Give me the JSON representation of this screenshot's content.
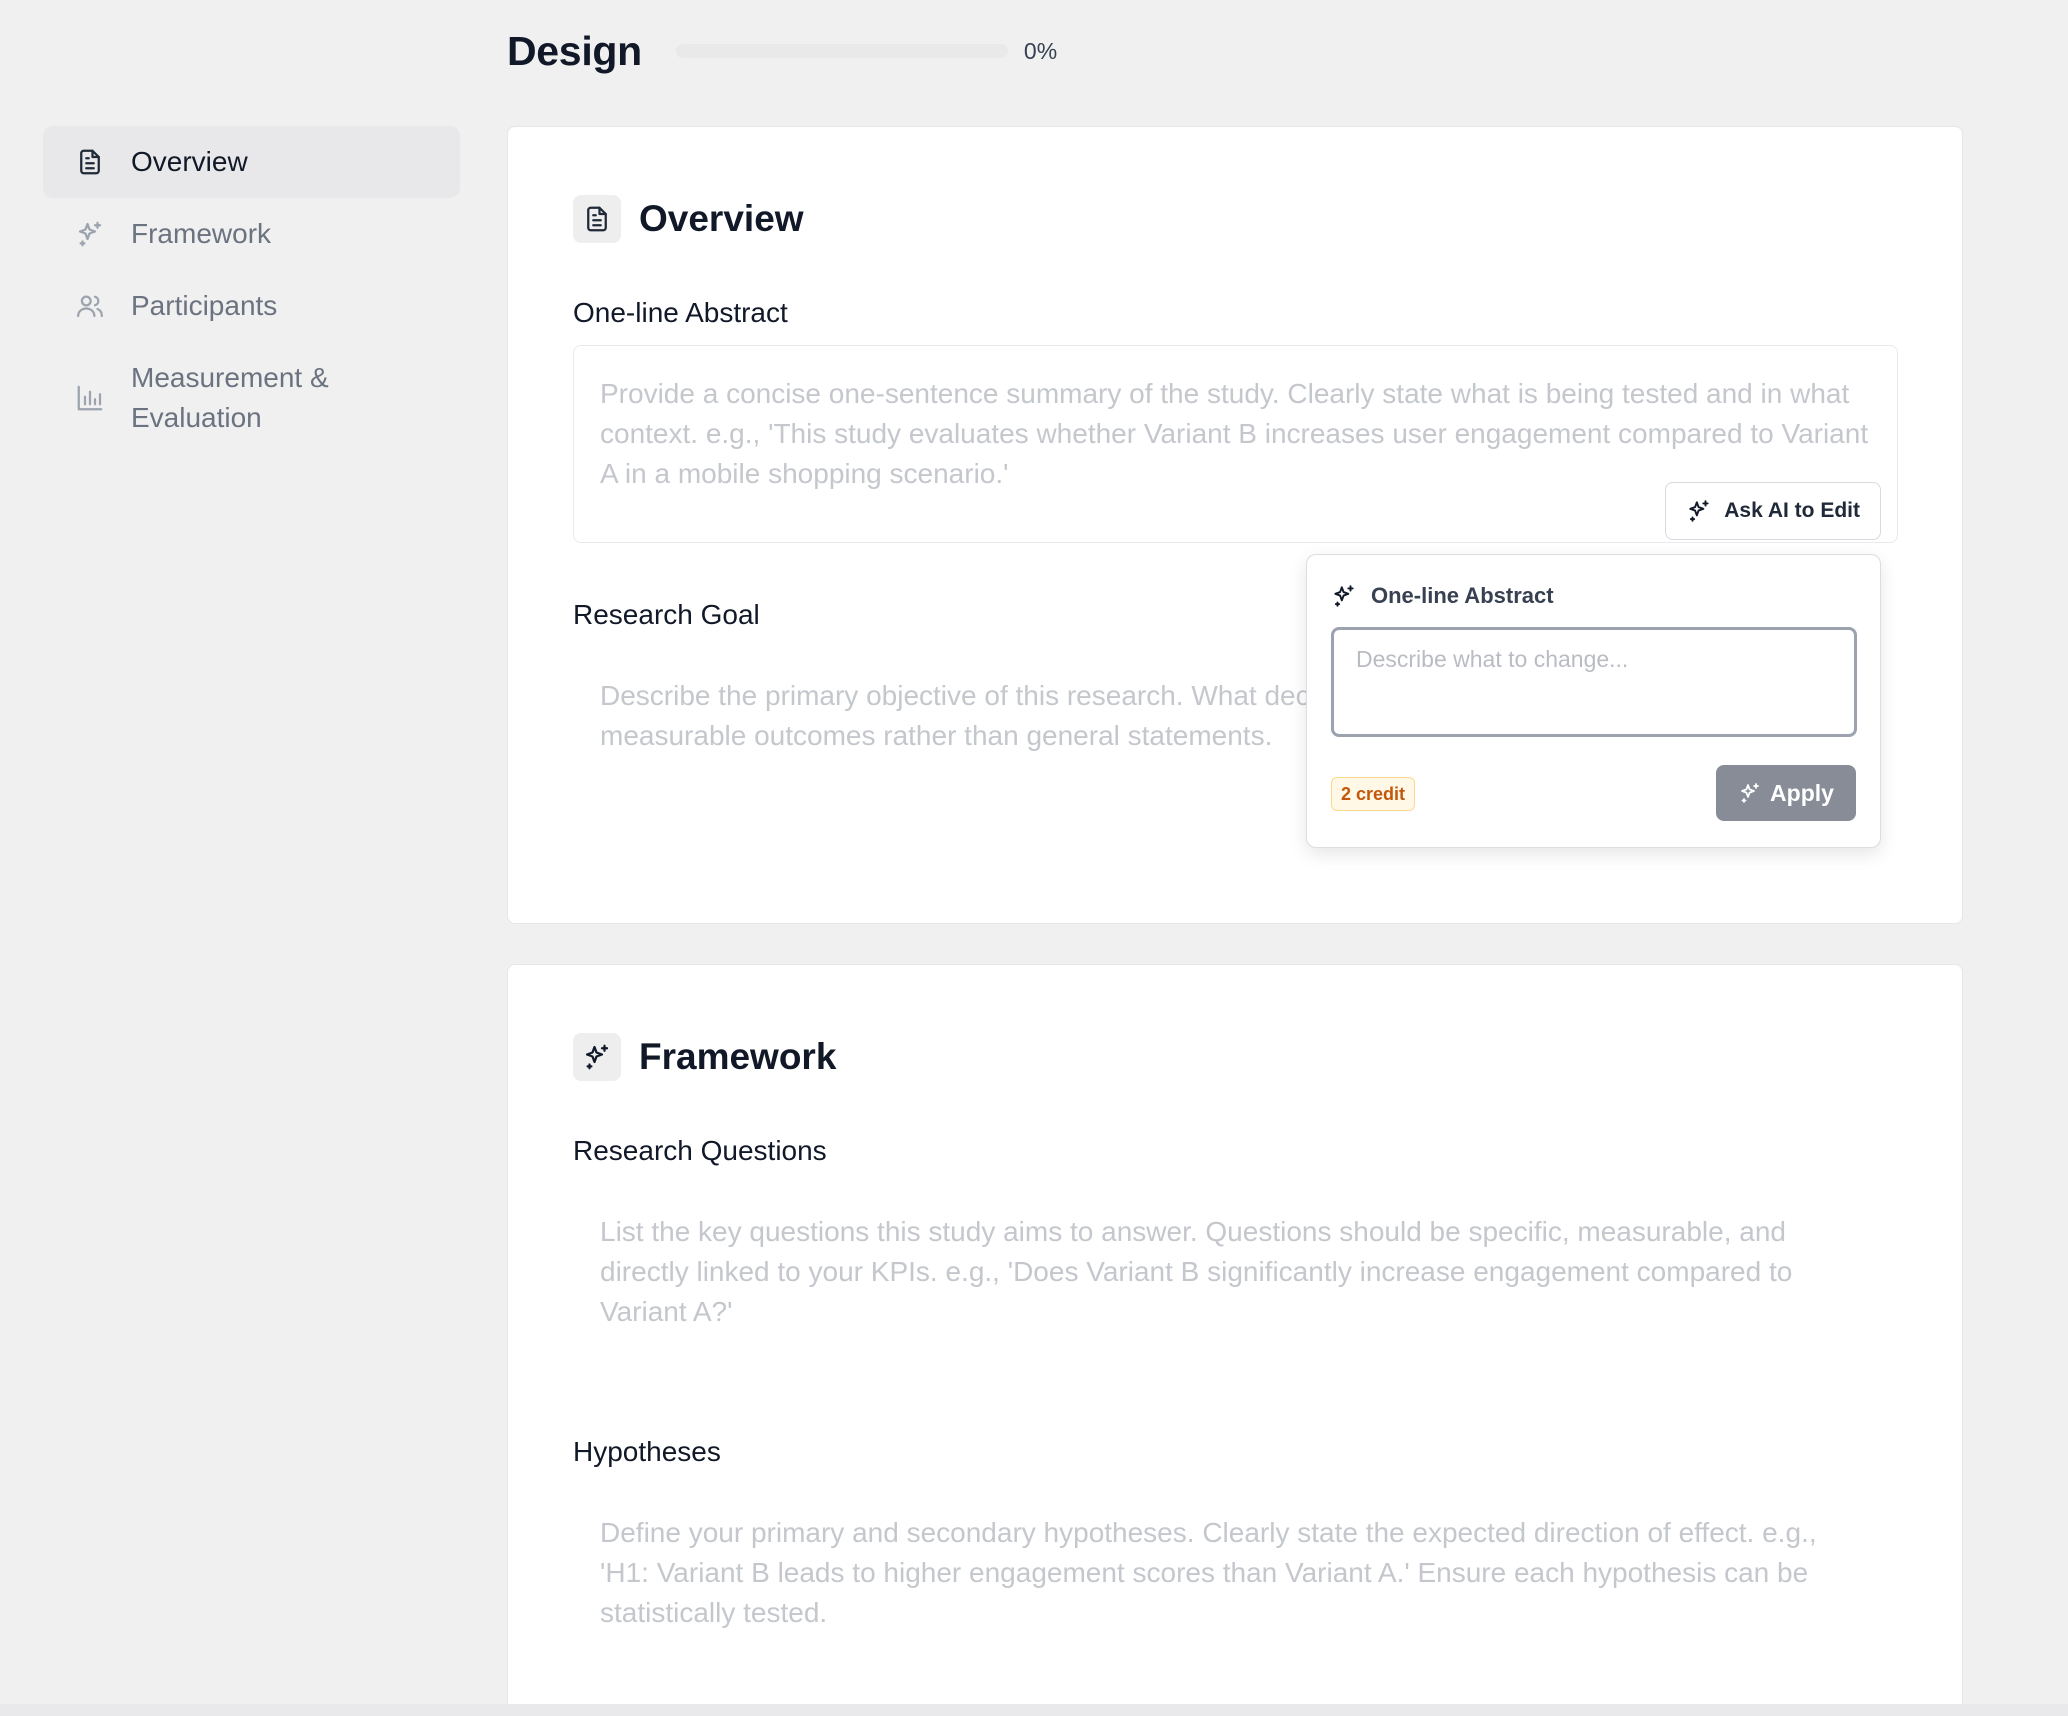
{
  "header": {
    "title": "Design",
    "progress_label": "0%",
    "progress_value": 0
  },
  "sidebar": {
    "items": [
      {
        "label": "Overview",
        "icon": "document-icon",
        "active": true
      },
      {
        "label": "Framework",
        "icon": "sparkles-icon",
        "active": false
      },
      {
        "label": "Participants",
        "icon": "users-icon",
        "active": false
      },
      {
        "label": "Measurement & Evaluation",
        "icon": "bar-chart-icon",
        "active": false
      }
    ]
  },
  "overview": {
    "title": "Overview",
    "abstract_label": "One-line Abstract",
    "abstract_placeholder": "Provide a concise one-sentence summary of the study. Clearly state what is being tested and in what context. e.g., 'This study evaluates whether Variant B increases user engagement compared to Variant A in a mobile shopping scenario.'",
    "ask_ai_label": "Ask AI to Edit",
    "goal_label": "Research Goal",
    "goal_placeholder": "Describe the primary objective of this research. What decision will the results support? Focus on measurable outcomes rather than general statements."
  },
  "popover": {
    "title": "One-line Abstract",
    "input_placeholder": "Describe what to change...",
    "credit": "2 credit",
    "apply_label": "Apply"
  },
  "framework": {
    "title": "Framework",
    "questions_label": "Research Questions",
    "questions_placeholder": "List the key questions this study aims to answer. Questions should be specific, measurable, and directly linked to your KPIs. e.g., 'Does Variant B significantly increase engagement compared to Variant A?'",
    "hypotheses_label": "Hypotheses",
    "hypotheses_placeholder": "Define your primary and secondary hypotheses. Clearly state the expected direction of effect. e.g., 'H1: Variant B leads to higher engagement scores than Variant A.' Ensure each hypothesis can be statistically tested."
  },
  "colors": {
    "page_bg": "#f0f0f0",
    "card_bg": "#ffffff",
    "active_nav_bg": "#e8e8ea",
    "apply_button": "#878c96",
    "credit_text": "#c2570c",
    "placeholder_text": "#c4c7cc"
  }
}
